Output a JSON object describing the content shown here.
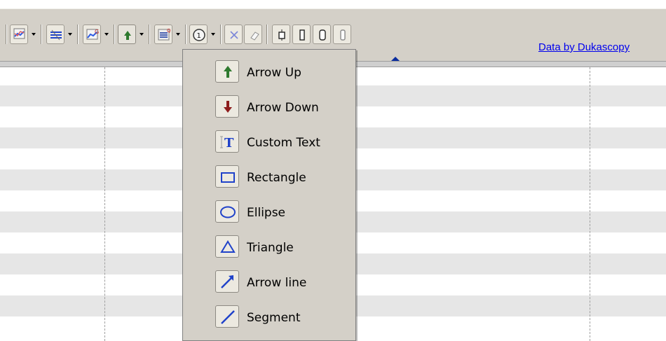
{
  "toolbar": {
    "data_link": "Data by Dukascopy"
  },
  "drawing_menu": {
    "items": [
      {
        "label": "Arrow Up",
        "icon": "arrow-up-icon"
      },
      {
        "label": "Arrow Down",
        "icon": "arrow-down-icon"
      },
      {
        "label": "Custom Text",
        "icon": "custom-text-icon"
      },
      {
        "label": "Rectangle",
        "icon": "rectangle-icon"
      },
      {
        "label": "Ellipse",
        "icon": "ellipse-icon"
      },
      {
        "label": "Triangle",
        "icon": "triangle-icon"
      },
      {
        "label": "Arrow line",
        "icon": "arrow-line-icon"
      },
      {
        "label": "Segment",
        "icon": "segment-icon"
      }
    ]
  },
  "colors": {
    "toolbar_bg": "#d4d0c8",
    "link": "#0000ee",
    "arrow_up": "#2f7a2f",
    "arrow_down": "#8e1d1d",
    "shape_blue": "#2042c9"
  }
}
